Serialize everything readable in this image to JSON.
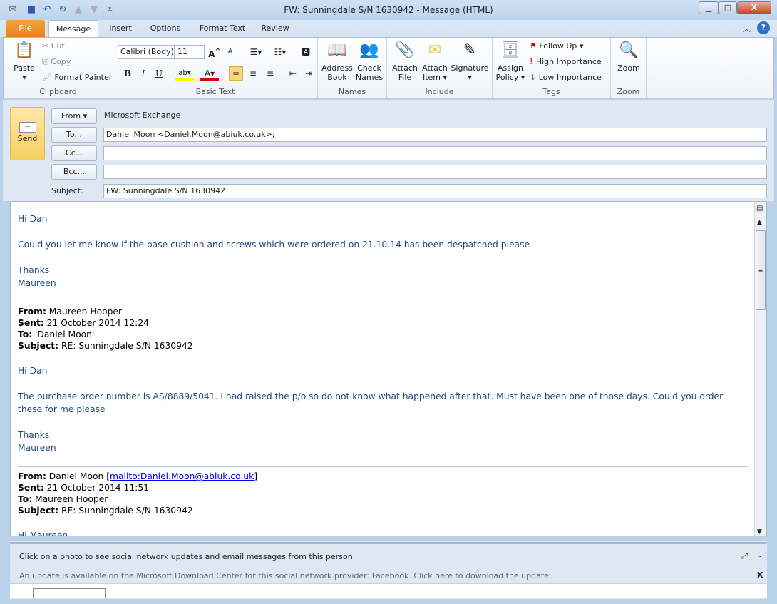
{
  "window": {
    "title": "FW: Sunningdale  S/N  1630942  -  Message (HTML)",
    "minimize": "▁",
    "maximize": "□",
    "close": "X"
  },
  "quick_access": {
    "save": "save-icon",
    "undo": "undo-icon",
    "redo": "redo-icon"
  },
  "tabs": [
    {
      "label": "File"
    },
    {
      "label": "Message",
      "active": true
    },
    {
      "label": "Insert"
    },
    {
      "label": "Options"
    },
    {
      "label": "Format Text"
    },
    {
      "label": "Review"
    }
  ],
  "ribbon": {
    "clipboard": {
      "label": "Clipboard",
      "paste": "Paste",
      "cut": "Cut",
      "copy": "Copy",
      "format_painter": "Format Painter"
    },
    "basic_text": {
      "label": "Basic Text",
      "font": "Calibri (Body)",
      "size": "11",
      "bold": "B",
      "italic": "I",
      "underline": "U",
      "highlight_color": "#ffff00",
      "font_color": "#e00000"
    },
    "names": {
      "label": "Names",
      "address_book_1": "Address",
      "address_book_2": "Book",
      "check_names_1": "Check",
      "check_names_2": "Names"
    },
    "include": {
      "label": "Include",
      "attach_file_1": "Attach",
      "attach_file_2": "File",
      "attach_item_1": "Attach",
      "attach_item_2": "Item ▾",
      "signature": "Signature"
    },
    "tags": {
      "label": "Tags",
      "assign_policy_1": "Assign",
      "assign_policy_2": "Policy ▾",
      "follow_up": "Follow Up ▾",
      "high_importance": "High Importance",
      "low_importance": "Low Importance"
    },
    "zoom": {
      "label": "Zoom",
      "zoom": "Zoom"
    }
  },
  "header": {
    "send": "Send",
    "from_button": "From ▾",
    "from_value": "Microsoft Exchange",
    "to_button": "To...",
    "to_value": "Daniel Moon <Daniel.Moon@abiuk.co.uk>;",
    "cc_button": "Cc...",
    "cc_value": "",
    "bcc_button": "Bcc...",
    "bcc_value": "",
    "subject_label": "Subject:",
    "subject_value": "FW: Sunningdale  S/N  1630942"
  },
  "body": {
    "text_color": "#1f497d",
    "greeting": "Hi Dan",
    "line1": "Could you let me know if the base cushion and screws which were ordered on 21.10.14 has been despatched please",
    "thanks": "Thanks",
    "sign": "Maureen",
    "msg2": {
      "from_label": "From:",
      "from": " Maureen Hooper",
      "sent_label": "Sent:",
      "sent": " 21 October 2014 12:24",
      "to_label": "To:",
      "to": " 'Daniel Moon'",
      "subject_label": "Subject:",
      "subject": " RE: Sunningdale S/N 1630942",
      "greeting": "Hi Dan",
      "line1": "The purchase order number is AS/8889/5041.  I had raised the p/o so do not know what happened after that.  Must have been one of those days.  Could you order",
      "line2": "these for me please",
      "thanks": "Thanks",
      "sign": "Maureen"
    },
    "msg3": {
      "from_label": "From:",
      "from": " Daniel Moon [",
      "mailto": "mailto:Daniel.Moon@abiuk.co.uk",
      "from_end": "]",
      "sent_label": "Sent:",
      "sent": " 21 October 2014 11:51",
      "to_label": "To:",
      "to": " Maureen Hooper",
      "subject_label": "Subject:",
      "subject": " RE: Sunningdale S/N 1630942",
      "greeting": "Hi Maureen"
    }
  },
  "social": {
    "info": "Click on a photo to see social network updates and email messages from this person.",
    "update": "An update is available on the Microsoft Download Center for this social network provider: Facebook. Click here to download the update.",
    "close": "X"
  }
}
